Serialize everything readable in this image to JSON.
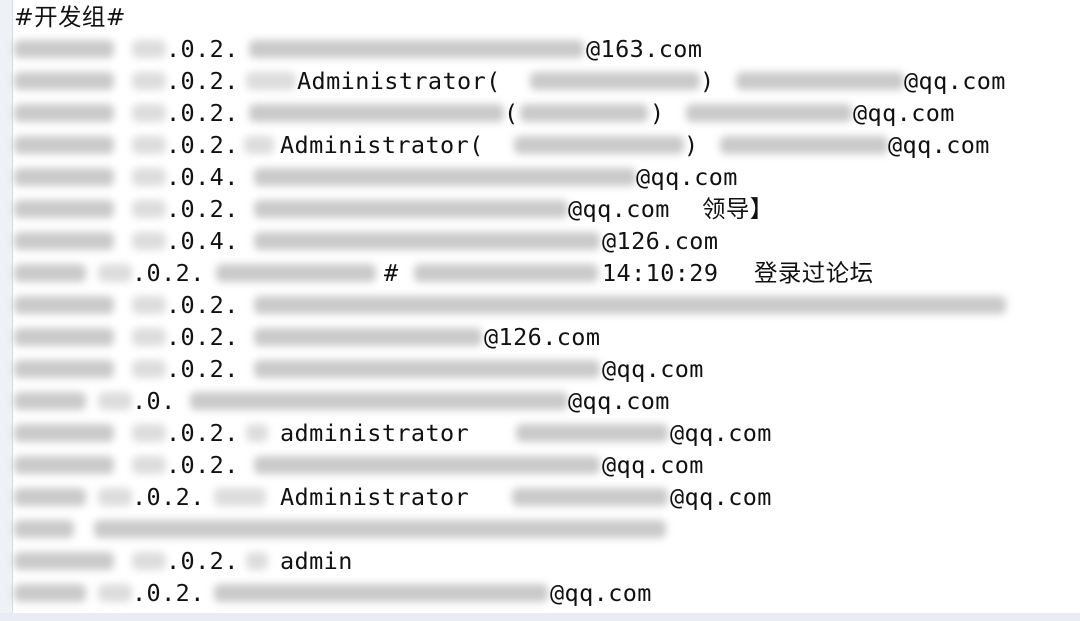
{
  "editor": {
    "title": "#开发组#",
    "lines": [
      {
        "ip": ".0.2.",
        "text": "",
        "email": "@163.com",
        "note": ""
      },
      {
        "ip": ".0.2.",
        "text": "Administrator(",
        "close": ")",
        "email": "@qq.com",
        "note": ""
      },
      {
        "ip": ".0.2.",
        "text": "(",
        "close": ")",
        "email": "@qq.com",
        "note": ""
      },
      {
        "ip": ".0.2.",
        "text": "Administrator(",
        "close": ")",
        "email": "@qq.com",
        "note": ""
      },
      {
        "ip": ".0.4.",
        "text": "",
        "email": "@qq.com",
        "note": ""
      },
      {
        "ip": ".0.2.",
        "text": "",
        "email": "@qq.com",
        "note": "领导】"
      },
      {
        "ip": ".0.4.",
        "text": "",
        "email": "@126.com",
        "note": ""
      },
      {
        "ip": ".0.2.",
        "text": "#",
        "email": "",
        "time": "14:10:29",
        "note": "登录过论坛"
      },
      {
        "ip": ".0.2.",
        "text": "",
        "email": "",
        "note": ""
      },
      {
        "ip": ".0.2.",
        "text": "",
        "email": "@126.com",
        "note": ""
      },
      {
        "ip": ".0.2.",
        "text": "",
        "email": "@qq.com",
        "note": ""
      },
      {
        "ip": ".0.",
        "text": "",
        "email": "@qq.com",
        "note": ""
      },
      {
        "ip": ".0.2.",
        "text": "administrator",
        "email": "@qq.com",
        "note": ""
      },
      {
        "ip": ".0.2.",
        "text": "",
        "email": "@qq.com",
        "note": ""
      },
      {
        "ip": ".0.2.",
        "text": "Administrator",
        "email": "@qq.com",
        "note": ""
      },
      {
        "ip": "",
        "text": "",
        "email": "",
        "note": ""
      },
      {
        "ip": ".0.2.",
        "text": "admin",
        "email": "",
        "note": ""
      },
      {
        "ip": ".0.2.",
        "text": "",
        "email": "@qq.com",
        "note": ""
      }
    ]
  }
}
